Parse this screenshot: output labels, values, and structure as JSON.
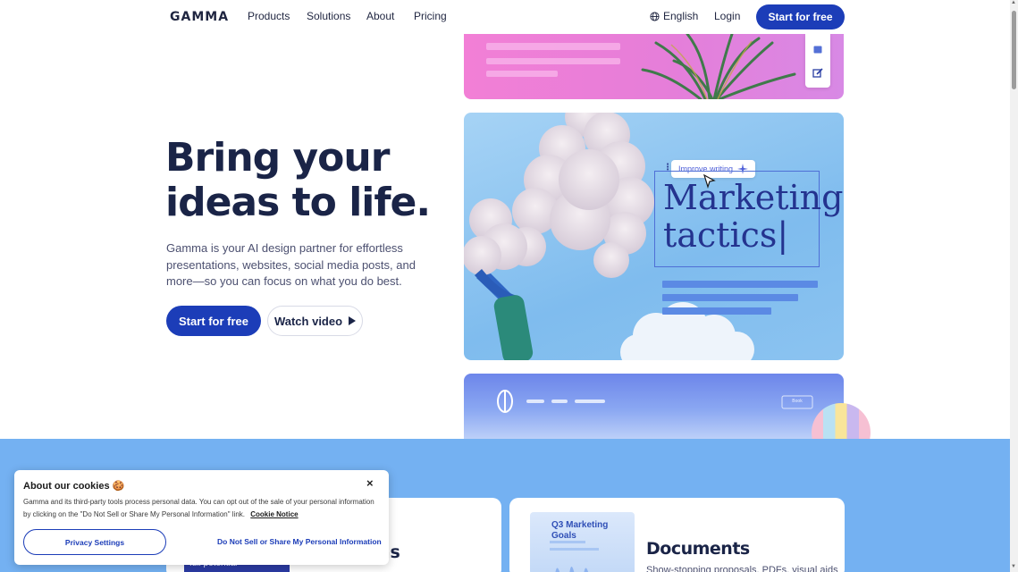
{
  "nav": {
    "logo": "GAMMA",
    "links": [
      "Products",
      "Solutions",
      "About",
      "Pricing"
    ],
    "language": "English",
    "login": "Login",
    "cta": "Start for free"
  },
  "hero": {
    "title_line1": "Bring your",
    "title_line2": "ideas to life.",
    "description": "Gamma is your AI design partner for effortless presentations, websites, social media posts, and more—so you can focus on what you do best.",
    "primary_button": "Start for free",
    "secondary_button": "Watch video"
  },
  "showcase": {
    "improve_label": "Improve writing",
    "heading_line1": "Marketing",
    "heading_line2": "tactics",
    "book_label": "Book"
  },
  "features": {
    "left_title_fragment": "ns",
    "left_thumb_text": "full potential",
    "right_title": "Documents",
    "right_desc": "Show-stopping proposals, PDFs, visual aids",
    "doc_thumb_title": "Q3 Marketing Goals"
  },
  "cookie": {
    "title": "About our cookies 🍪",
    "text": "Gamma and its third-party tools process personal data. You can opt out of the sale of your personal information by clicking on the \"Do Not Sell or Share My Personal Information\" link.",
    "link": "Cookie Notice",
    "settings_button": "Privacy Settings",
    "dns_link": "Do Not Sell or Share My Personal Information",
    "close": "×"
  },
  "colors": {
    "brand": "#1c3db8",
    "text_dark": "#1a2447",
    "band": "#74b1f2"
  }
}
